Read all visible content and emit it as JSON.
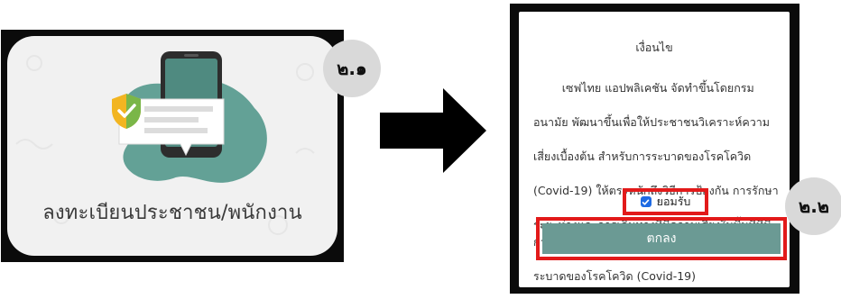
{
  "step_badges": {
    "first": "๒.๑",
    "second": "๒.๒"
  },
  "register_card": {
    "label": "ลงทะเบียนประชาชน/พนักงาน",
    "icon": "phone-shield-chat-icon",
    "colors": {
      "frame": "#0b0b0b",
      "card": "#f1f1f1",
      "blob": "#63a196",
      "phone": "#2d2d2d"
    }
  },
  "arrow": {
    "icon": "arrow-right-icon",
    "color": "#000000"
  },
  "conditions_dialog": {
    "title": "เงื่อนไข",
    "body_lines": [
      "        เซฟไทย แอปพลิเคชัน จัดทำขึ้นโดยกรม",
      "อนามัย พัฒนาขึ้นเพื่อให้ประชาชนวิเคราะห์ความ",
      "เสี่ยงเบื้องต้น สำหรับการระบาดของโรคโควิด",
      "(Covid-19) ให้ตระหนักถึงวิธีการป้องกัน การรักษา",
      "ระยะห่างและการเดินทางที่มีความเสี่ยงในพื้นที่ที่มีการ",
      "ระบาดของโรคโควิด (Covid-19)"
    ],
    "accept_label": "ยอมรับ",
    "accept_checked": true,
    "ok_button_label": "ตกลง",
    "colors": {
      "highlight": "#e21a1a",
      "button": "#6b9a94",
      "checkbox": "#1e6ae3"
    }
  }
}
